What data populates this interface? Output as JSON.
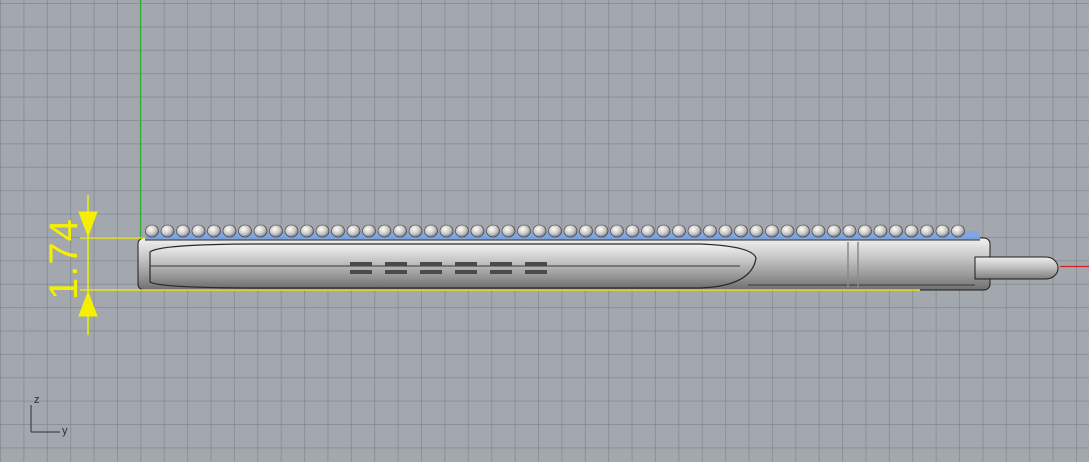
{
  "viewport": {
    "dimension": {
      "value": "1.74"
    },
    "axis_icon": {
      "vertical_label": "z",
      "horizontal_label": "y"
    },
    "colors": {
      "background": "#a3a8ae",
      "grid": "#787e84",
      "dimension": "#f4f000",
      "green_axis": "#2fae2f",
      "red_axis": "#d02020",
      "gem_blue": "#6e9ee8"
    }
  }
}
